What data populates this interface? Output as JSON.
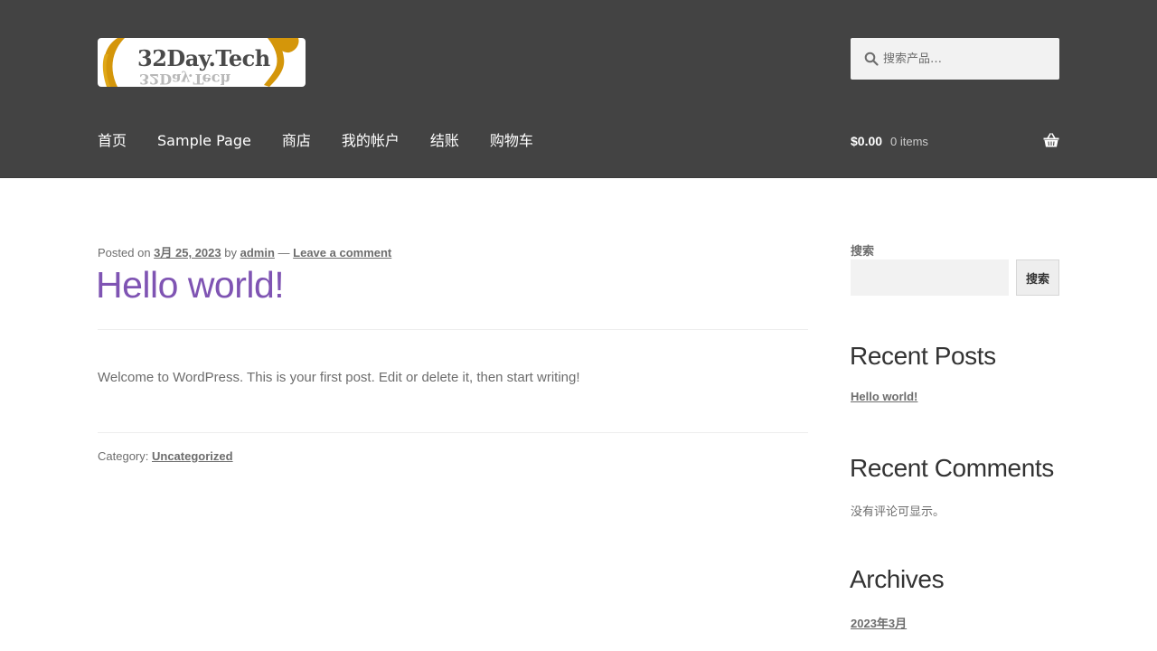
{
  "header": {
    "logo_text": "32Day.Tech",
    "search_placeholder": "搜索产品…",
    "nav": [
      "首页",
      "Sample Page",
      "商店",
      "我的帐户",
      "结账",
      "购物车"
    ],
    "cart_amount": "$0.00",
    "cart_count": "0 items"
  },
  "post": {
    "posted_on_label": "Posted on",
    "date": "3月 25, 2023",
    "by_label": "by",
    "author": "admin",
    "separator": "—",
    "comment_link": "Leave a comment",
    "title": "Hello world!",
    "body": "Welcome to WordPress. This is your first post. Edit or delete it, then start writing!",
    "category_label": "Category:",
    "category": "Uncategorized"
  },
  "sidebar": {
    "search_label": "搜索",
    "search_button": "搜索",
    "recent_posts_title": "Recent Posts",
    "recent_posts": [
      "Hello world!"
    ],
    "recent_comments_title": "Recent Comments",
    "no_comments": "没有评论可显示。",
    "archives_title": "Archives",
    "archives": [
      "2023年3月"
    ]
  },
  "colors": {
    "header_bg": "#434343",
    "accent": "#7f54b3",
    "text": "#6d6d6d",
    "logo_gold": "#d4960a"
  }
}
